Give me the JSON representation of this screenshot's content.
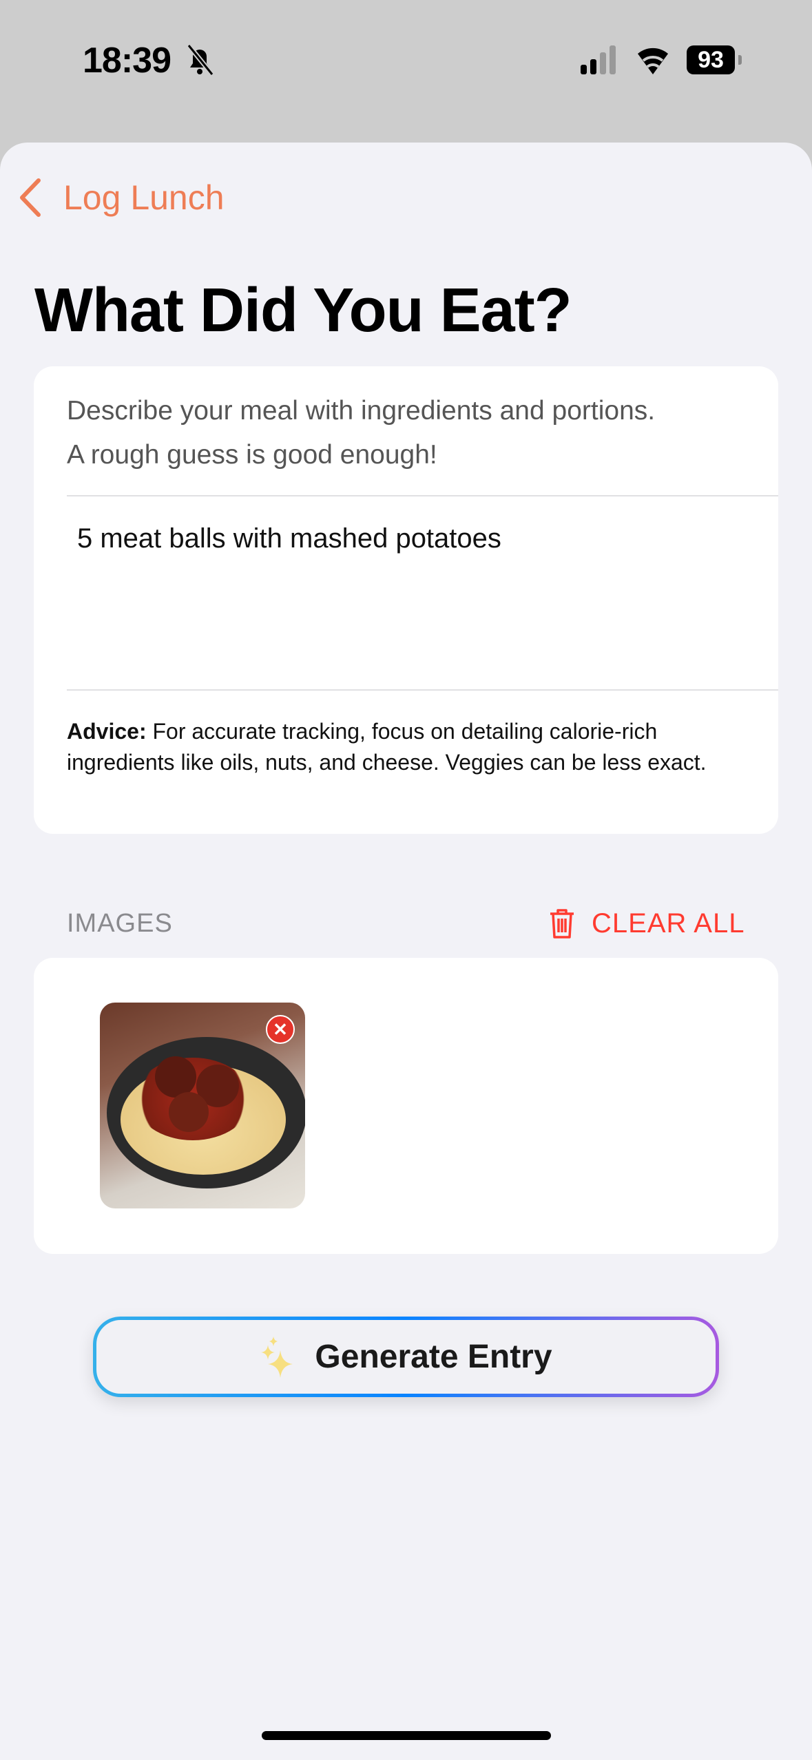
{
  "status_bar": {
    "time": "18:39",
    "silent_icon": "bell-slash-icon",
    "battery": "93"
  },
  "nav": {
    "back_label": "Log Lunch",
    "accent": "#ee7d55"
  },
  "page": {
    "title": "What Did You Eat?"
  },
  "meal_card": {
    "description_line1": "Describe your meal with ingredients and portions.",
    "description_line2": "A rough guess is good enough!",
    "input_value": "5 meat balls with mashed potatoes",
    "advice_label": "Advice:",
    "advice_text": " For accurate tracking, focus on detailing calorie-rich ingredients like oils, nuts, and cheese. Veggies can be less exact."
  },
  "images": {
    "section_label": "IMAGES",
    "clear_all_label": "CLEAR ALL",
    "clear_color": "#ff3b30",
    "remove_icon": "x-circle-icon"
  },
  "generate_button": {
    "label": "Generate Entry",
    "icon": "sparkles-icon"
  }
}
